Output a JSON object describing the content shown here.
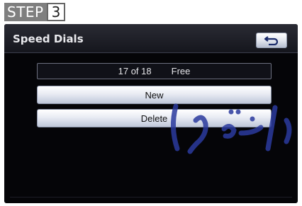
{
  "step": {
    "label": "STEP",
    "number": "3"
  },
  "screen": {
    "title": "Speed Dials",
    "back_icon": "back-arrow-icon",
    "counter": {
      "used": "17 of 18",
      "status": "Free"
    },
    "buttons": {
      "new": "New",
      "delete": "Delete"
    }
  },
  "colors": {
    "step_badge": "#7f7f7f",
    "screen_bg": "#050508",
    "button_gradient_top": "#ffffff",
    "button_gradient_bottom": "#bfc7d9",
    "watermark": "#2b3a9e"
  }
}
